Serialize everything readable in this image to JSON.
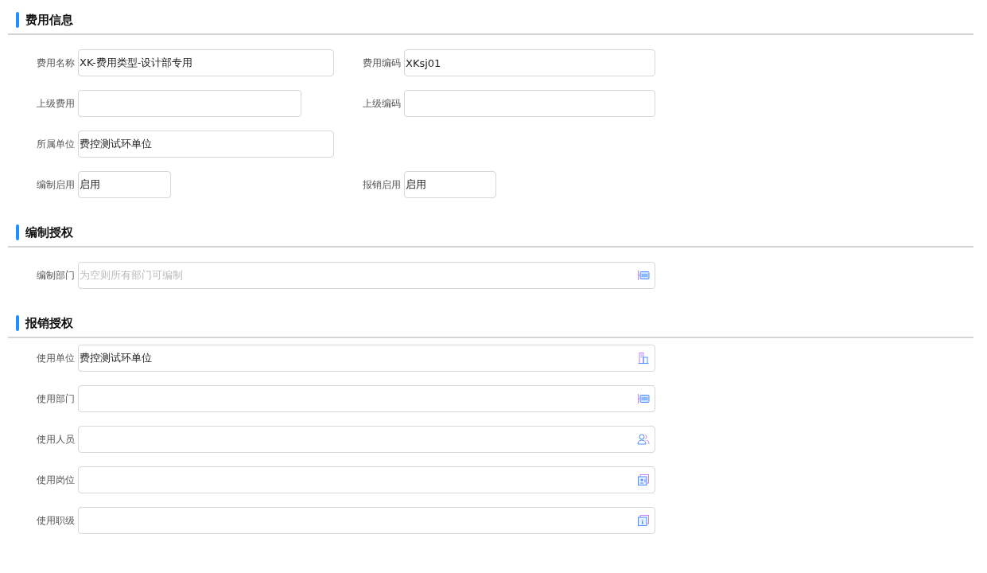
{
  "sections": [
    {
      "title": "费用信息",
      "rows": [
        {
          "fields": [
            {
              "label": "费用名称",
              "kind": "text",
              "value": "XK-费用类型-设计部专用"
            },
            {
              "label": "费用编码",
              "kind": "text",
              "value": "XKsj01"
            }
          ]
        },
        {
          "fields": [
            {
              "label": "上级费用",
              "kind": "text"
            },
            {
              "label": "上级编码",
              "kind": "text"
            }
          ]
        },
        {
          "fields": [
            {
              "label": "所属单位",
              "kind": "text",
              "value": "费控测试环单位"
            }
          ]
        },
        {
          "fields": [
            {
              "label": "编制启用",
              "kind": "text",
              "value": "启用"
            },
            {
              "label": "报销启用",
              "kind": "text",
              "value": "启用"
            }
          ]
        }
      ]
    },
    {
      "title": "编制授权",
      "rows": [
        {
          "fields": [
            {
              "label": "编制部门",
              "kind": "dept-picker",
              "placeholder": "为空则所有部门可编制"
            }
          ]
        }
      ]
    },
    {
      "title": "报销授权",
      "rows": [
        {
          "fields": [
            {
              "label": "使用单位",
              "kind": "unit-picker",
              "value": "费控测试环单位"
            }
          ]
        },
        {
          "fields": [
            {
              "label": "使用部门",
              "kind": "dept-picker"
            }
          ]
        },
        {
          "fields": [
            {
              "label": "使用人员",
              "kind": "person-picker"
            }
          ]
        },
        {
          "fields": [
            {
              "label": "使用岗位",
              "kind": "post-picker"
            }
          ]
        },
        {
          "fields": [
            {
              "label": "使用职级",
              "kind": "rank-picker"
            }
          ]
        }
      ]
    }
  ]
}
